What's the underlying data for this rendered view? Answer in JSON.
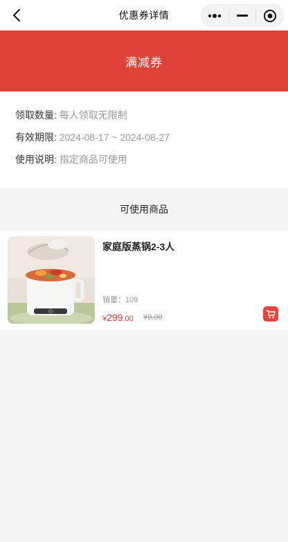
{
  "navbar": {
    "title": "优惠券详情",
    "back_icon": "chevron-left-icon",
    "capsule": {
      "more_icon": "more-dots-icon",
      "minimize_icon": "minimize-icon",
      "close_icon": "target-circle-icon"
    }
  },
  "coupon": {
    "title": "满减券",
    "accent": "#df4337"
  },
  "info": {
    "quantity_label": "领取数量:",
    "quantity_value": "每人领取无限制",
    "validity_label": "有效期限:",
    "validity_value": "2024-08-17 ~ 2024-08-27",
    "usage_label": "使用说明:",
    "usage_value": "指定商品可使用"
  },
  "products_section": {
    "title": "可使用商品",
    "items": [
      {
        "name": "家庭版蒸锅2-3人",
        "sales_text": "销量：109",
        "price_symbol": "¥",
        "price_int": "299",
        "price_dec": ".00",
        "original_price": "¥0.00",
        "image_icon": "electric-hotpot-image",
        "cart_icon": "cart-icon"
      }
    ]
  }
}
